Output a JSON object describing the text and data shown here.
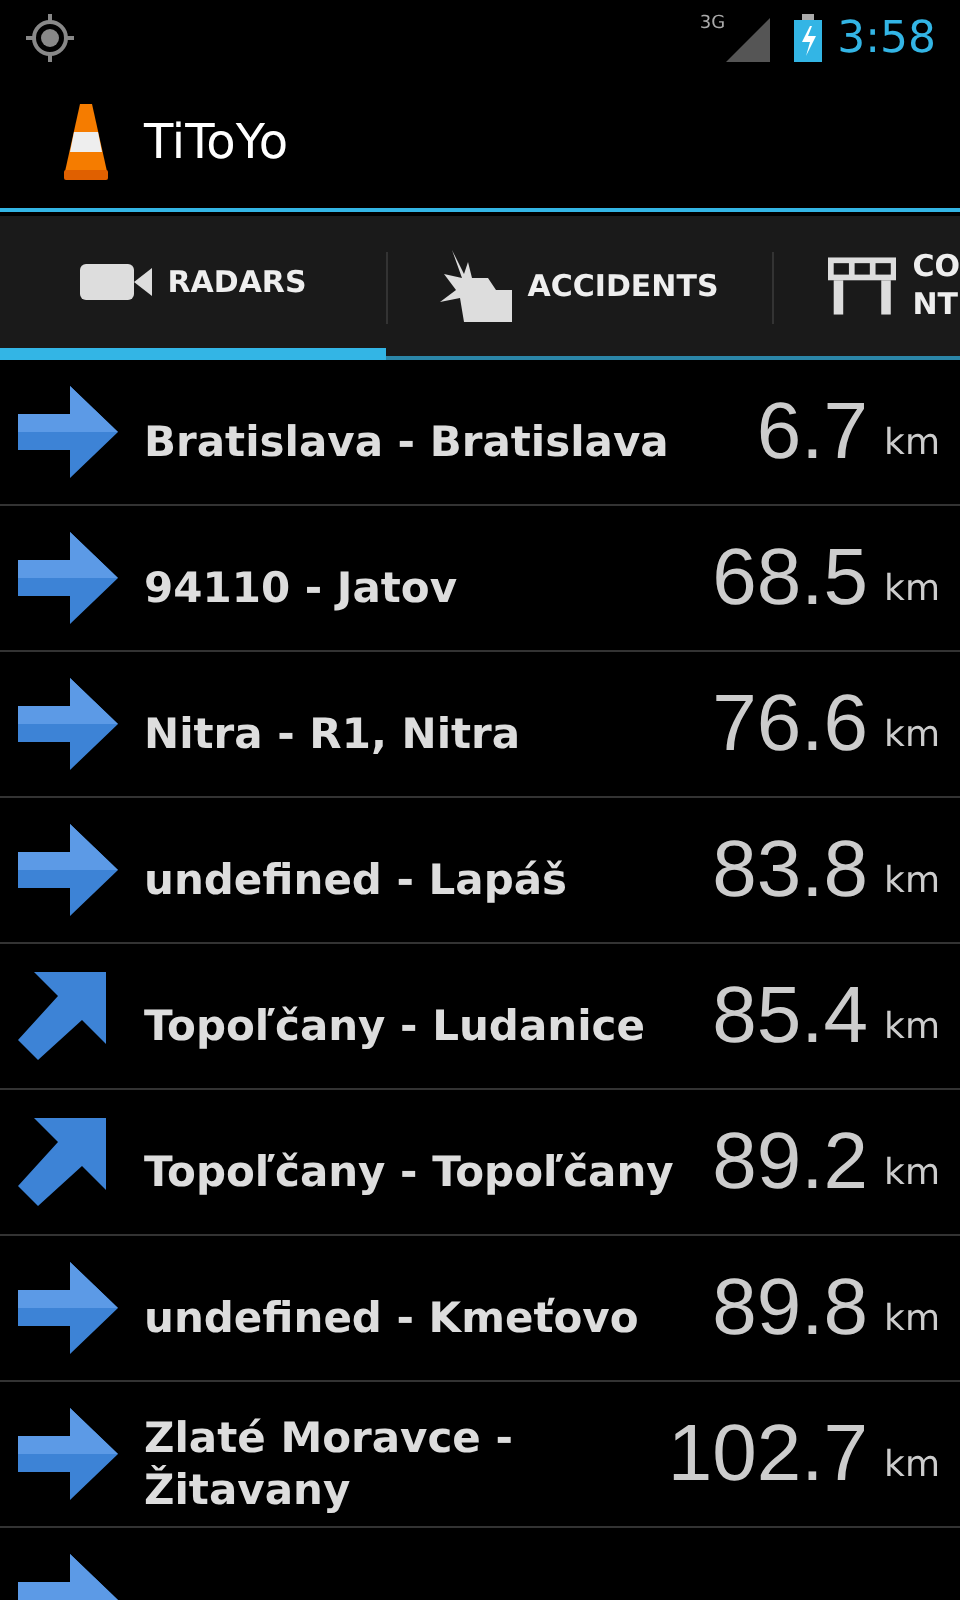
{
  "status_bar": {
    "network": "3G",
    "time": "3:58"
  },
  "app_bar": {
    "title": "TiToYo"
  },
  "tabs": [
    {
      "kind": "camera",
      "label": [
        "RADARS"
      ],
      "selected": true
    },
    {
      "kind": "crash",
      "label": [
        "ACCIDENTS"
      ],
      "selected": false
    },
    {
      "kind": "barrier",
      "label": [
        "CO",
        "NT"
      ],
      "selected": false
    }
  ],
  "rows": [
    {
      "kind": "right",
      "name": "Bratislava - Bratislava",
      "distance": "6.7",
      "unit": "km"
    },
    {
      "kind": "right",
      "name": "94110 - Jatov",
      "distance": "68.5",
      "unit": "km"
    },
    {
      "kind": "right",
      "name": "Nitra - R1, Nitra",
      "distance": "76.6",
      "unit": "km"
    },
    {
      "kind": "right",
      "name": "undefined - Lapáš",
      "distance": "83.8",
      "unit": "km"
    },
    {
      "kind": "up-right",
      "name": "Topoľčany - Ludanice",
      "distance": "85.4",
      "unit": "km"
    },
    {
      "kind": "up-right",
      "name": "Topoľčany - Topoľčany",
      "distance": "89.2",
      "unit": "km"
    },
    {
      "kind": "right",
      "name": "undefined - Kmeťovo",
      "distance": "89.8",
      "unit": "km"
    },
    {
      "kind": "right",
      "name": "Zlaté Moravce - Žitavany",
      "distance": "102.7",
      "unit": "km"
    },
    {
      "kind": "right"
    }
  ]
}
